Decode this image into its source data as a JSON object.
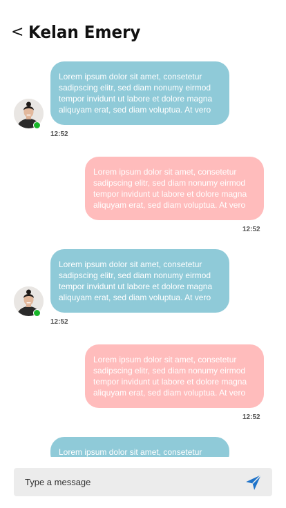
{
  "header": {
    "back_label": "<",
    "title": "Kelan Emery"
  },
  "messages": [
    {
      "direction": "incoming",
      "text": "Lorem ipsum dolor sit amet, consetetur sadipscing elitr, sed diam nonumy eirmod tempor invidunt ut labore et dolore magna aliquyam erat, sed diam voluptua. At vero",
      "time": "12:52"
    },
    {
      "direction": "outgoing",
      "text": "Lorem ipsum dolor sit amet, consetetur sadipscing elitr, sed diam nonumy eirmod tempor invidunt ut labore et dolore magna aliquyam erat, sed diam voluptua. At vero",
      "time": "12:52"
    },
    {
      "direction": "incoming",
      "text": "Lorem ipsum dolor sit amet, consetetur sadipscing elitr, sed diam nonumy eirmod tempor invidunt ut labore et dolore magna aliquyam erat, sed diam voluptua. At vero",
      "time": "12:52"
    },
    {
      "direction": "outgoing",
      "text": "Lorem ipsum dolor sit amet, consetetur sadipscing elitr, sed diam nonumy eirmod tempor invidunt ut labore et dolore magna aliquyam erat, sed diam voluptua. At vero",
      "time": "12:52"
    },
    {
      "direction": "incoming",
      "text": "Lorem ipsum dolor sit amet, consetetur",
      "time": ""
    }
  ],
  "composer": {
    "placeholder": "Type a message",
    "send_icon": "send-icon"
  },
  "colors": {
    "incoming_bubble": "#8fcad8",
    "outgoing_bubble": "#ffbcbc",
    "online": "#18b52a",
    "send_icon": "#1f73c9",
    "composer_bg": "#ececec"
  }
}
